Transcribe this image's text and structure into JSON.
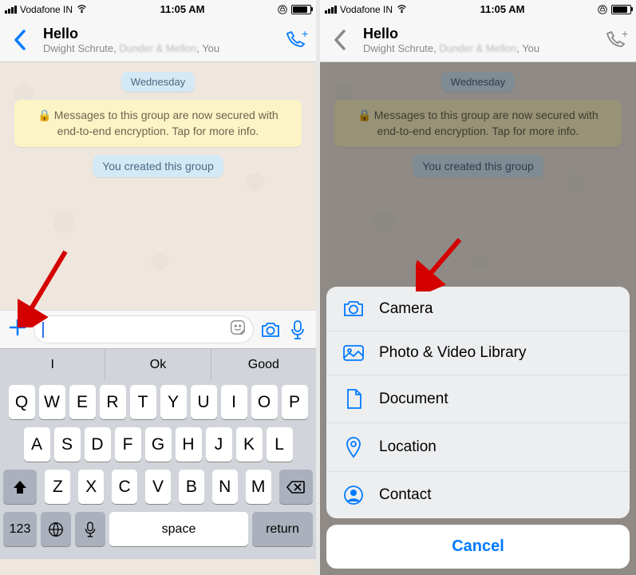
{
  "status": {
    "carrier": "Vodafone IN",
    "time": "11:05 AM"
  },
  "chat": {
    "title": "Hello",
    "members_prefix": "Dwight Schrute, ",
    "members_blur": "Dunder & Mellon",
    "members_suffix": " You",
    "date": "Wednesday",
    "encryption_notice": "Messages to this group are now secured with end-to-end encryption. Tap for more info.",
    "created_notice": "You created this group"
  },
  "suggestions": [
    "I",
    "Ok",
    "Good"
  ],
  "keyboard": {
    "row1": [
      "Q",
      "W",
      "E",
      "R",
      "T",
      "Y",
      "U",
      "I",
      "O",
      "P"
    ],
    "row2": [
      "A",
      "S",
      "D",
      "F",
      "G",
      "H",
      "J",
      "K",
      "L"
    ],
    "row3": [
      "Z",
      "X",
      "C",
      "V",
      "B",
      "N",
      "M"
    ],
    "numkey": "123",
    "space": "space",
    "return": "return"
  },
  "sheet": {
    "items": [
      {
        "label": "Camera"
      },
      {
        "label": "Photo & Video Library"
      },
      {
        "label": "Document"
      },
      {
        "label": "Location"
      },
      {
        "label": "Contact"
      }
    ],
    "cancel": "Cancel"
  }
}
